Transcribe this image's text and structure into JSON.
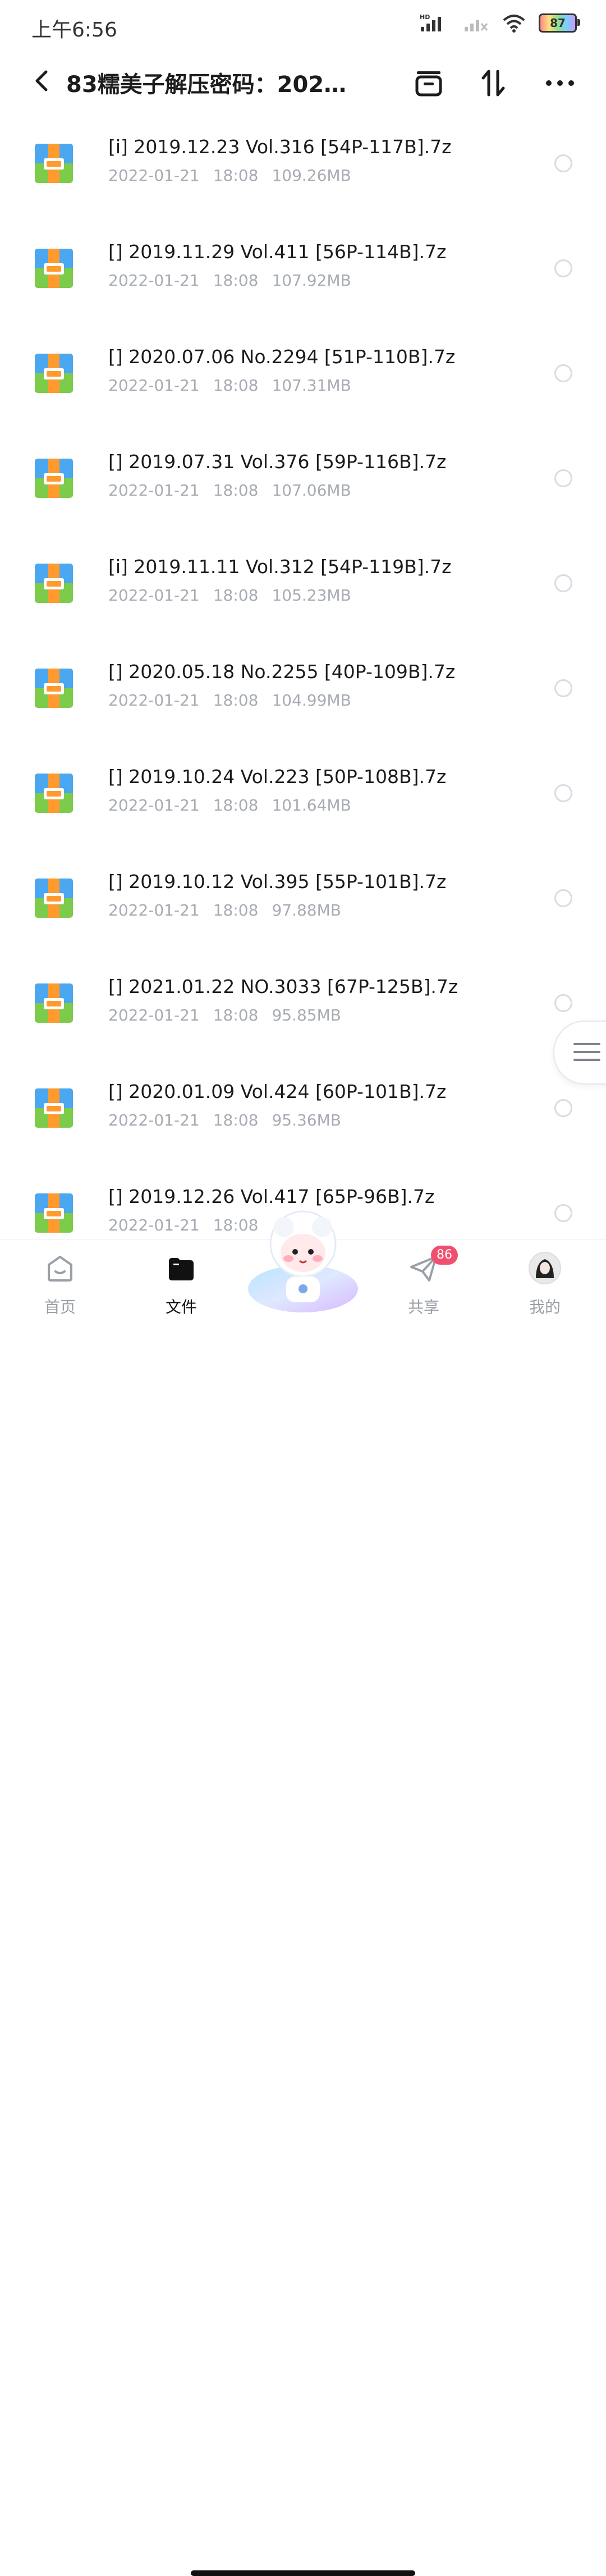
{
  "status_bar": {
    "time": "上午6:56",
    "battery": "87",
    "network_label": "HD"
  },
  "header": {
    "title": "83糯美子解压密码：202…"
  },
  "files": [
    {
      "name": "[i] 2019.12.23 Vol.316   [54P-117B].7z",
      "date": "2022-01-21",
      "time": "18:08",
      "size": "109.26MB"
    },
    {
      "name": "[] 2019.11.29 Vol.411   [56P-114B].7z",
      "date": "2022-01-21",
      "time": "18:08",
      "size": "107.92MB"
    },
    {
      "name": "[] 2020.07.06 No.2294   [51P-110B].7z",
      "date": "2022-01-21",
      "time": "18:08",
      "size": "107.31MB"
    },
    {
      "name": "[] 2019.07.31 Vol.376   [59P-116B].7z",
      "date": "2022-01-21",
      "time": "18:08",
      "size": "107.06MB"
    },
    {
      "name": "[i] 2019.11.11 Vol.312   [54P-119B].7z",
      "date": "2022-01-21",
      "time": "18:08",
      "size": "105.23MB"
    },
    {
      "name": "[] 2020.05.18 No.2255   [40P-109B].7z",
      "date": "2022-01-21",
      "time": "18:08",
      "size": "104.99MB"
    },
    {
      "name": "[] 2019.10.24 Vol.223   [50P-108B].7z",
      "date": "2022-01-21",
      "time": "18:08",
      "size": "101.64MB"
    },
    {
      "name": "[] 2019.10.12 Vol.395   [55P-101B].7z",
      "date": "2022-01-21",
      "time": "18:08",
      "size": "97.88MB"
    },
    {
      "name": "[] 2021.01.22 NO.3033   [67P-125B].7z",
      "date": "2022-01-21",
      "time": "18:08",
      "size": "95.85MB"
    },
    {
      "name": "[] 2020.01.09 Vol.424   [60P-101B].7z",
      "date": "2022-01-21",
      "time": "18:08",
      "size": "95.36MB"
    },
    {
      "name": "[] 2019.12.26 Vol.417   [65P-96B].7z",
      "date": "2022-01-21",
      "time": "18:08",
      "size": ""
    }
  ],
  "nav": {
    "home": "首页",
    "files": "文件",
    "share": "共享",
    "share_badge": "86",
    "mine": "我的"
  },
  "colors": {
    "accent_badge": "#f0506e",
    "meta_text": "#a7abb3"
  }
}
